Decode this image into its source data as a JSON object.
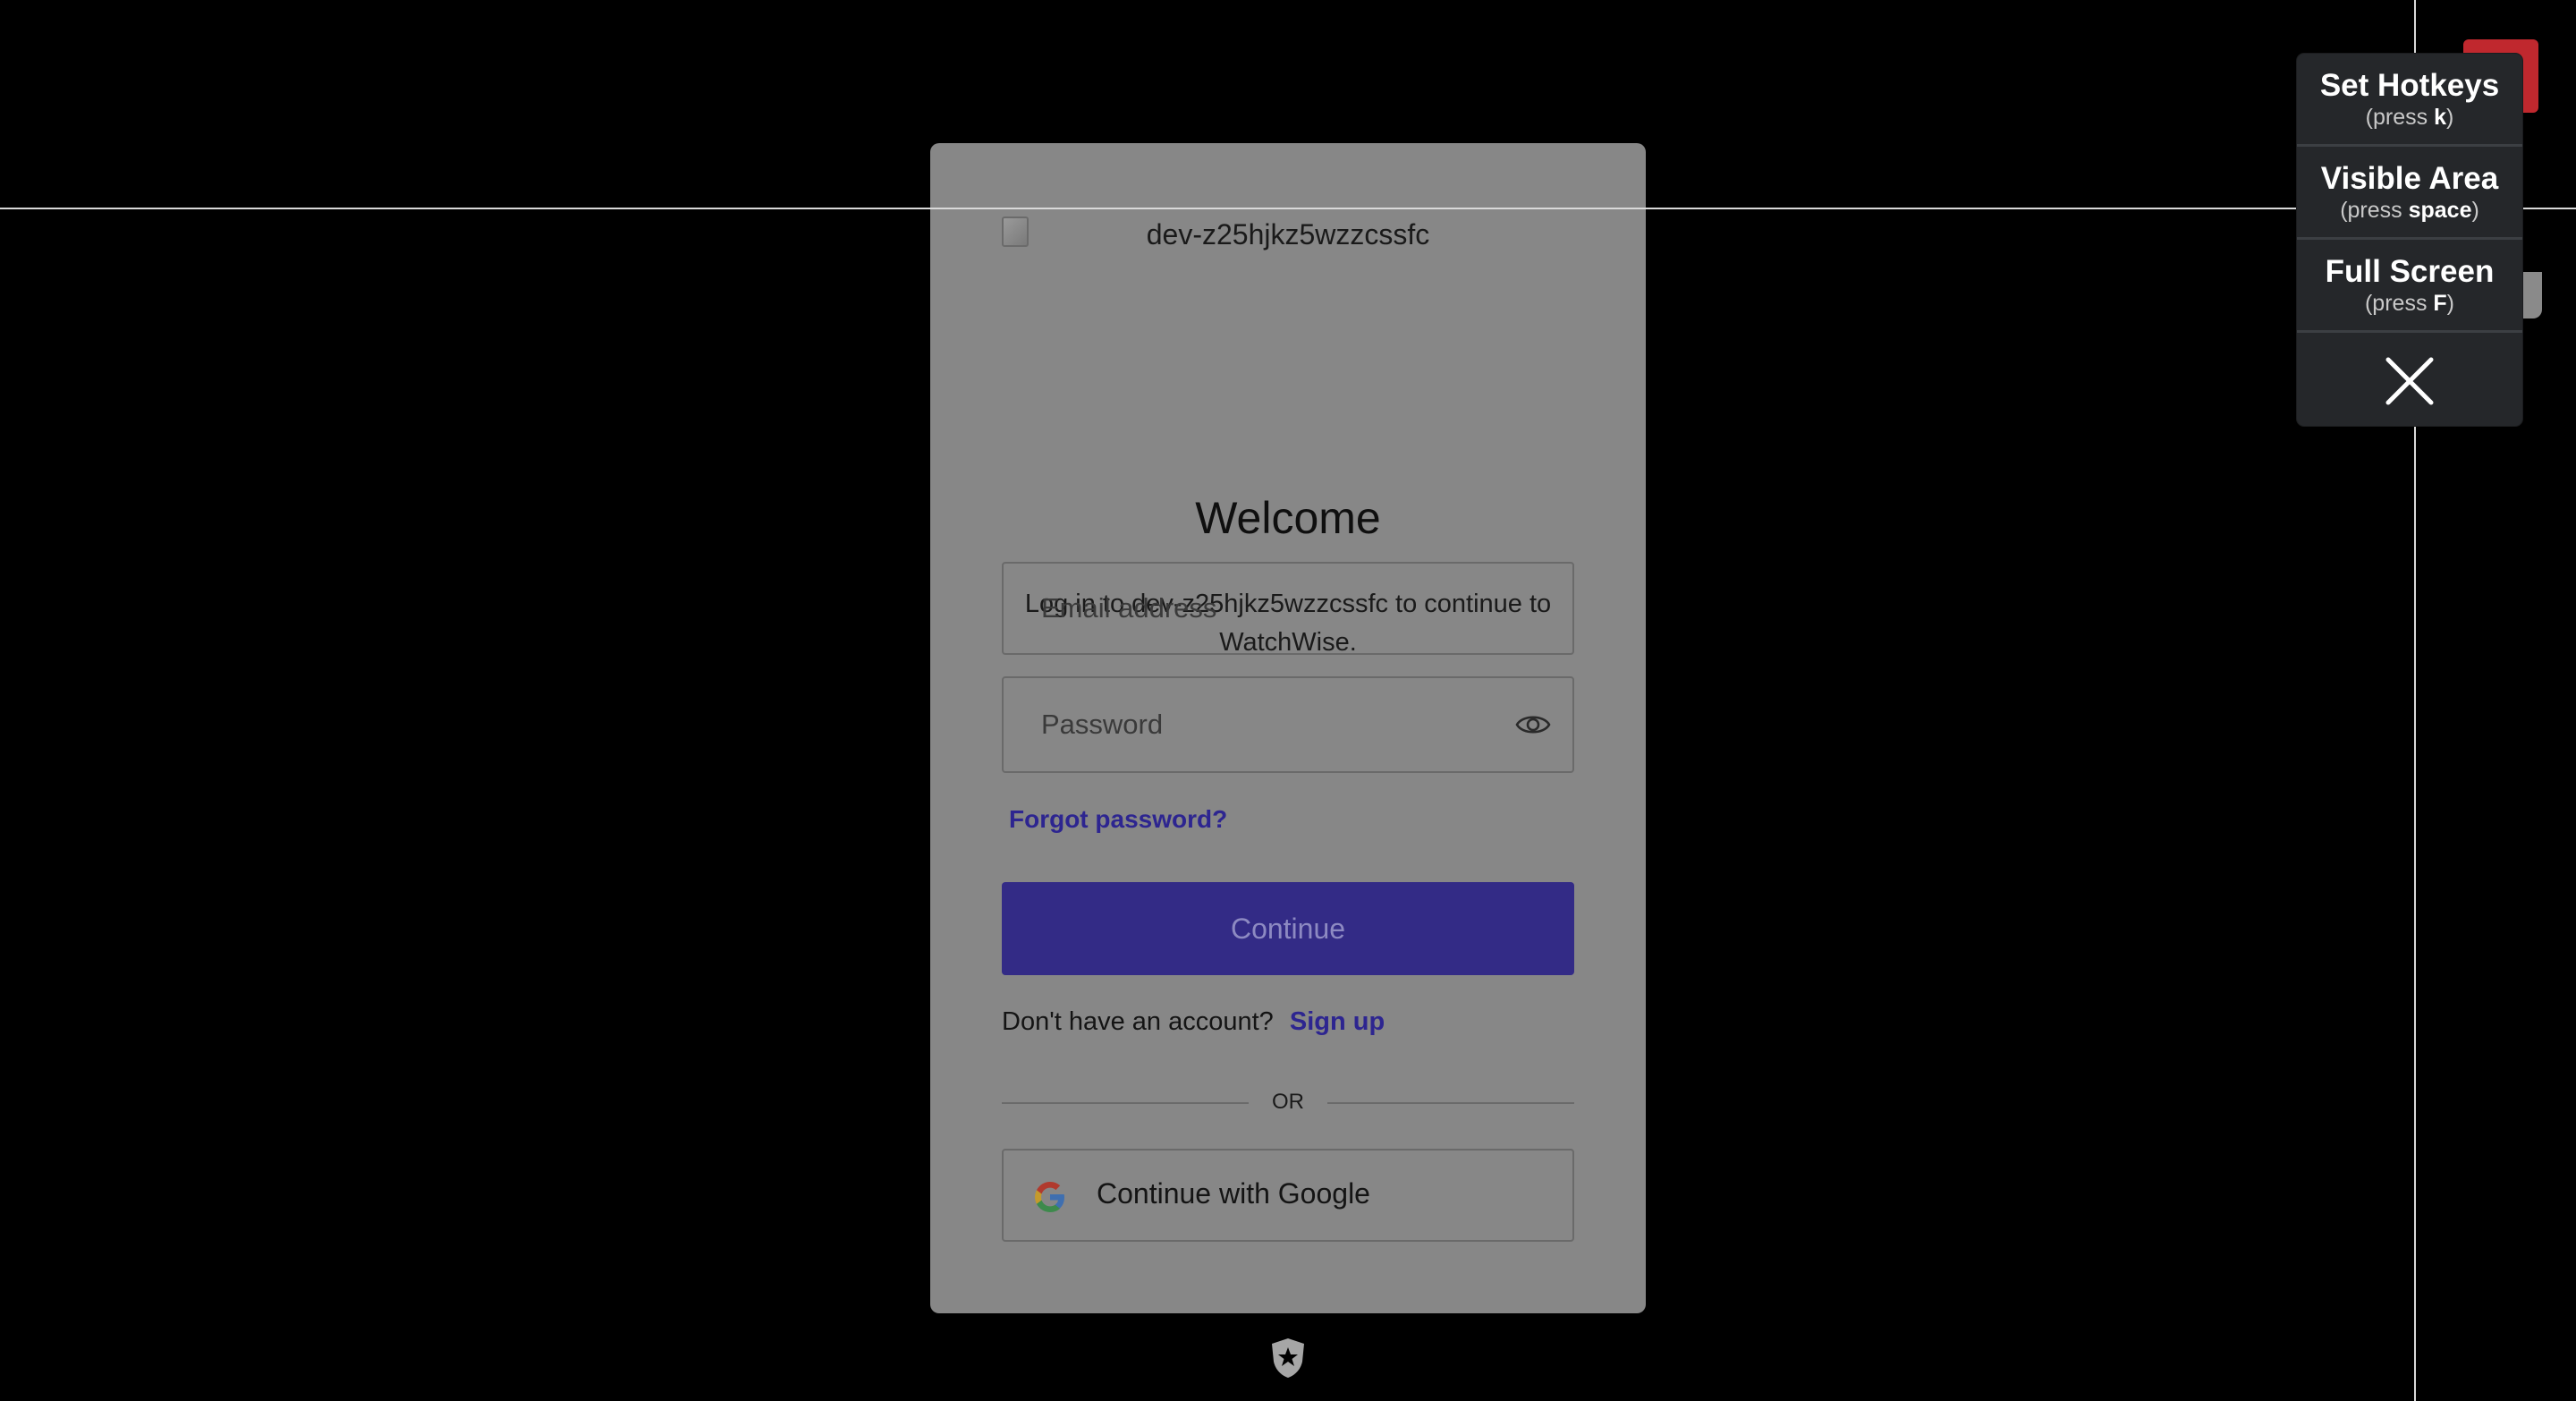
{
  "login": {
    "logo_alt": "dev-z25hjkz5wzzcssfc",
    "title": "Welcome",
    "subtitle": "Log in to dev-z25hjkz5wzzcssfc to continue to WatchWise.",
    "email_placeholder": "Email address",
    "password_placeholder": "Password",
    "forgot_label": "Forgot password?",
    "continue_label": "Continue",
    "no_account_text": "Don't have an account?",
    "signup_label": "Sign up",
    "or_text": "OR",
    "google_label": "Continue with Google"
  },
  "hotkey_menu": {
    "items": [
      {
        "title": "Set Hotkeys",
        "hint_prefix": "(press ",
        "key": "k",
        "hint_suffix": ")"
      },
      {
        "title": "Visible Area",
        "hint_prefix": "(press ",
        "key": "space",
        "hint_suffix": ")"
      },
      {
        "title": "Full Screen",
        "hint_prefix": "(press ",
        "key": "F",
        "hint_suffix": ")"
      }
    ]
  },
  "icons": {
    "eye": "eye-icon",
    "google": "google-icon",
    "close": "close-icon",
    "footer": "auth0-shield-icon"
  },
  "colors": {
    "background": "#000000",
    "card": "#878787",
    "primary_button": "#332b86",
    "link": "#2d2590",
    "menu": "#25272a",
    "red_badge": "#c0282e"
  }
}
